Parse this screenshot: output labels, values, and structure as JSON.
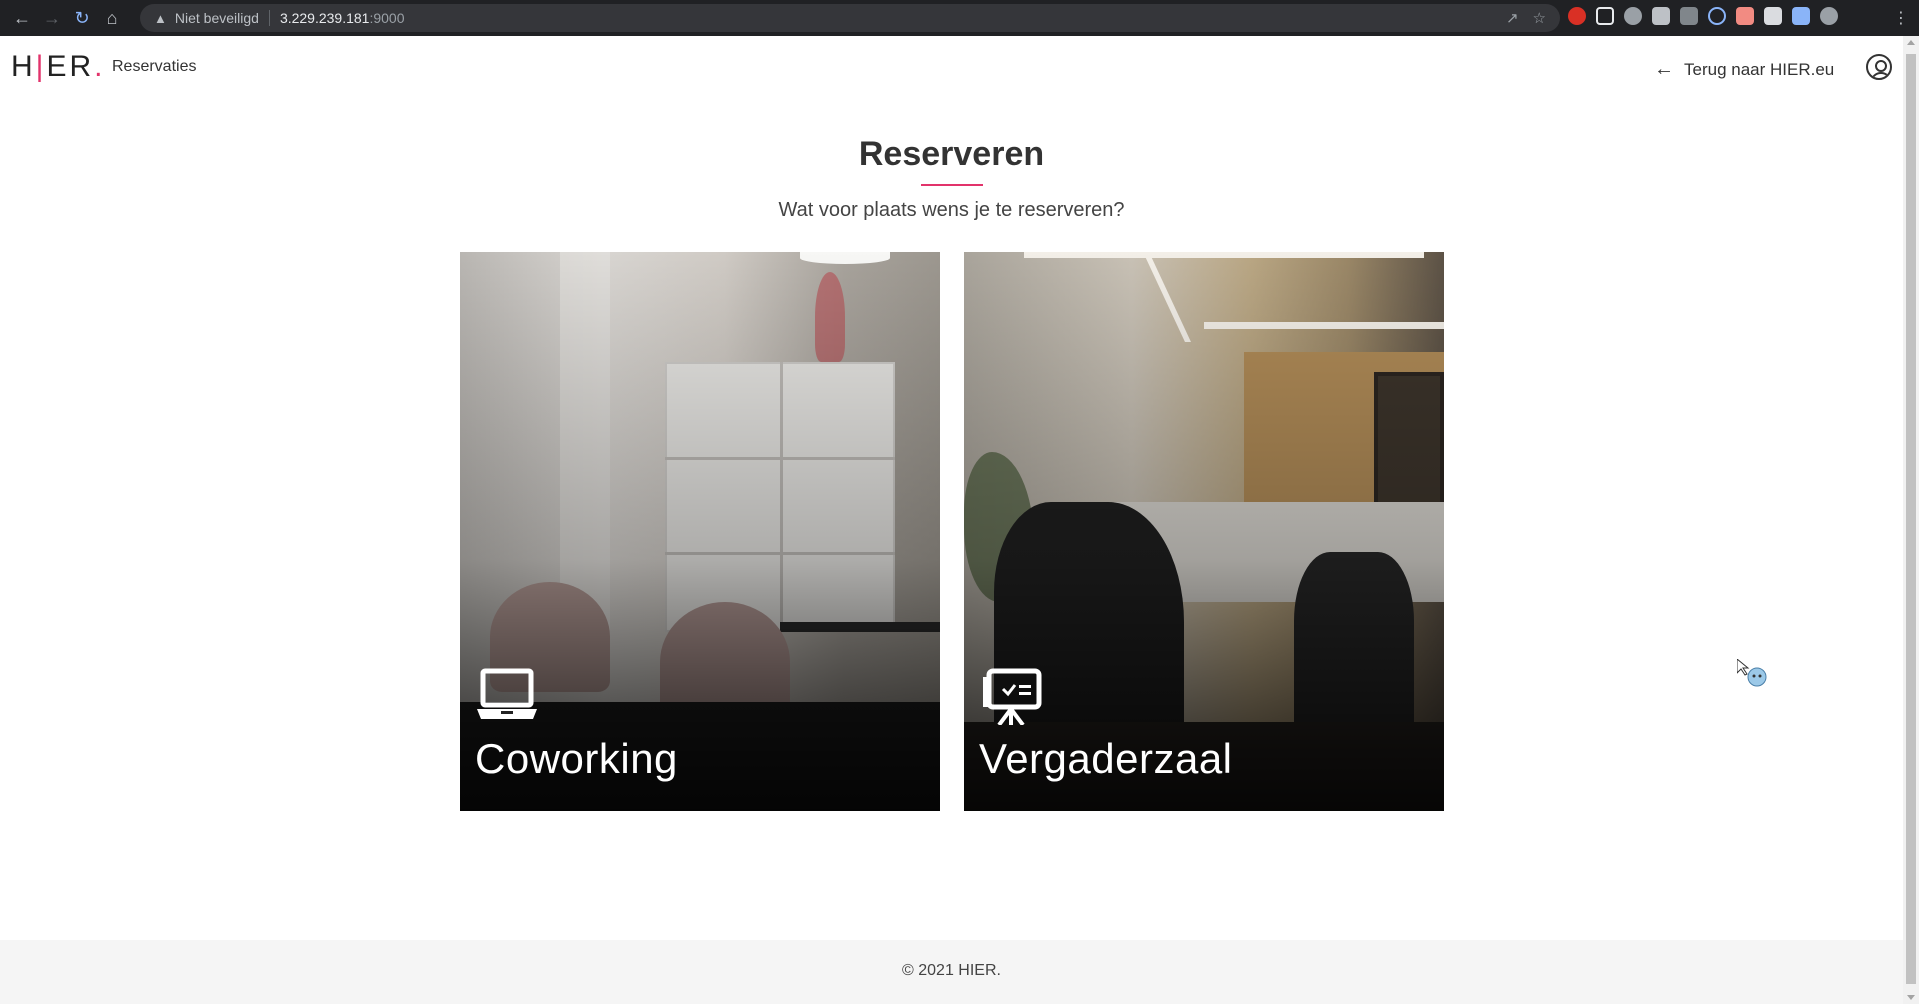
{
  "browser": {
    "security_label": "Niet beveiligd",
    "url_host": "3.229.239.181",
    "url_port": ":9000"
  },
  "header": {
    "logo": {
      "h": "H",
      "bar": "|",
      "rest": "ER",
      "dot": "."
    },
    "nav_link": "Reservaties",
    "back_link": "Terug naar HIER.eu"
  },
  "main": {
    "title": "Reserveren",
    "subtitle": "Wat voor plaats wens je te reserveren?",
    "cards": [
      {
        "label": "Coworking",
        "icon": "laptop-icon"
      },
      {
        "label": "Vergaderzaal",
        "icon": "presentation-board-icon"
      }
    ]
  },
  "footer": {
    "copyright": "© 2021 HIER."
  },
  "colors": {
    "accent": "#e2336b",
    "chrome": "#202124",
    "footer_bg": "#f5f5f5"
  }
}
